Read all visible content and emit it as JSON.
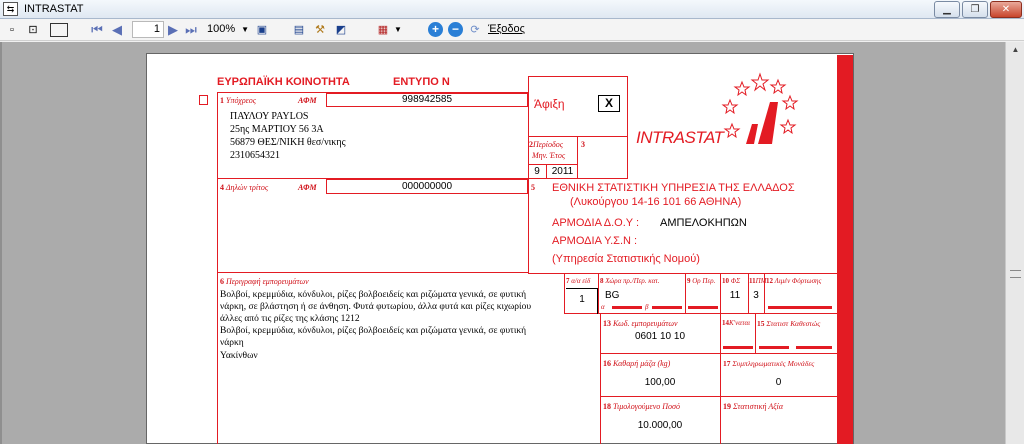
{
  "window": {
    "title": "INTRASTAT",
    "icon": "app-icon",
    "controls": [
      "minimize-icon",
      "restore-icon",
      "close-icon"
    ]
  },
  "toolbar": {
    "page_number": "1",
    "zoom": "100%",
    "exit_label": "Έξοδος"
  },
  "form": {
    "header_left": "ΕΥΡΩΠΑΪΚΗ ΚΟΙΝΟΤΗΤΑ",
    "header_form": "ΕΝΤΥΠΟ Ν",
    "flow": {
      "label": "Άφιξη",
      "mark": "X"
    },
    "box1": {
      "label_num": "1",
      "label": "Υπόχρεος",
      "afm_label": "ΑΦΜ",
      "afm": "998942585",
      "lines": [
        "ΠΑΥΛΟΥ PAYLOS",
        "25ης ΜΑΡΤΙΟΥ 56 3Α",
        "56879 ΘΕΣ/ΝΙΚΗ θεσ/νικης",
        "2310654321"
      ]
    },
    "box2": {
      "label_num": "2",
      "label": "Περίοδος",
      "sub": "Μηv. Έτος",
      "month": "9",
      "year": "2011"
    },
    "box3": {
      "label_num": "3"
    },
    "intrastat_logo": "INTRASTAT",
    "box4": {
      "label_num": "4",
      "label": "Δηλών τρίτος",
      "afm_label": "ΑΦΜ",
      "afm": "000000000"
    },
    "box5": {
      "label_num": "5",
      "line1": "ΕΘΝΙΚΗ ΣΤΑΤΙΣΤΙΚΗ ΥΠΗΡΕΣΙΑ ΤΗΣ ΕΛΛΑΔΟΣ",
      "line2": "(Λυκούργου 14-16   101 66 ΑΘΗΝΑ)",
      "doy_label": "ΑΡΜΟΔΙΑ Δ.Ο.Υ :",
      "doy_value": "ΑΜΠΕΛΟΚΗΠΩΝ",
      "ysn_label": "ΑΡΜΟΔΙΑ Υ.Σ.Ν :",
      "ysn_note": "(Υπηρεσία Στατιστικής Νομού)"
    },
    "box6": {
      "label_num": "6",
      "label": "Περιγραφή εμπορευμάτων",
      "lines": [
        "Βολβοί, κρεμμύδια, κόνδυλοι, ρίζες βολβοειδείς και ριζώματα γενικά, σε φυτική",
        "νάρκη, σε βλάστηση ή σε άνθηση. Φυτά φυτωρίου, άλλα φυτά και ρίζες κιχωρίου",
        "άλλες από τις ρίζες της κλάσης 1212",
        "Βολβοί, κρεμμύδια, κόνδυλοι, ρίζες βολβοειδείς και ριζώματα γενικά, σε φυτική",
        "νάρκη",
        "Υακίνθων"
      ]
    },
    "box7": {
      "label_num": "7",
      "label": "α/α είδ",
      "value": "1"
    },
    "box8": {
      "label_num": "8",
      "label": "Χώρα πρ./Περ. κατ.",
      "value": "BG",
      "sub_a": "α",
      "sub_b": "β"
    },
    "box9": {
      "label_num": "9",
      "label": "Ορ Περ."
    },
    "box10": {
      "label_num": "10",
      "label": "ΦΣ",
      "value": "11"
    },
    "box11": {
      "label_num": "11",
      "label": "ΠΜ",
      "value": "3"
    },
    "box12": {
      "label_num": "12",
      "label": "Λιμέν Φόρτωσης"
    },
    "box13": {
      "label_num": "13",
      "label": "Κωδ. εμπορευμάτων",
      "value": "0601 10 10"
    },
    "box14": {
      "label_num": "14",
      "label": "Κ'ναται"
    },
    "box15": {
      "label_num": "15",
      "label": "Στατιστ Καθεστώς"
    },
    "box16": {
      "label_num": "16",
      "label": "Καθαρή μάζα (kg)",
      "value": "100,00"
    },
    "box17": {
      "label_num": "17",
      "label": "Συμπληρωματικές Μονάδες",
      "value": "0"
    },
    "box18": {
      "label_num": "18",
      "label": "Τιμολογούμενο Ποσό",
      "value": "10.000,00"
    },
    "box19": {
      "label_num": "19",
      "label": "Στατιστική Αξία"
    }
  },
  "colors": {
    "form_red": "#e31b23",
    "viewer_bg": "#ababab"
  }
}
